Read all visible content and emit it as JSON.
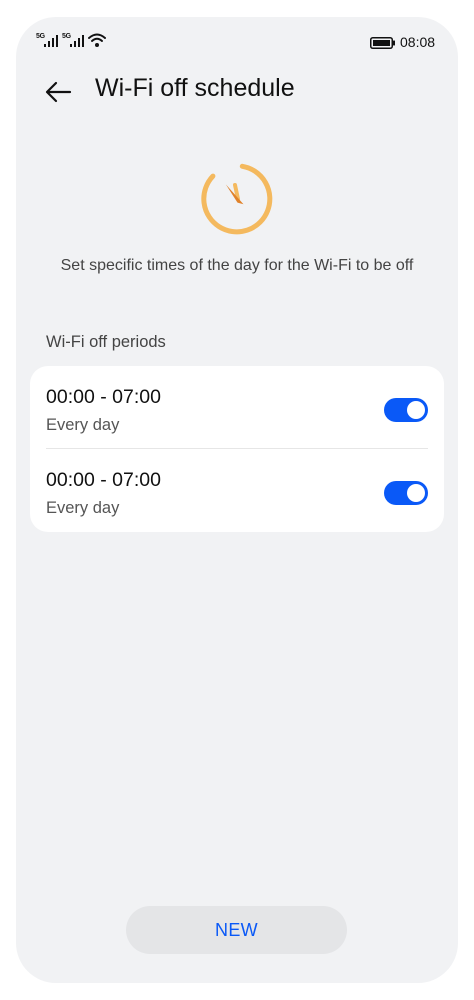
{
  "status_bar": {
    "signal_1_tag": "5G",
    "signal_2_tag": "5G",
    "wifi_icon": "wifi-icon",
    "battery_icon": "battery-icon",
    "time": "08:08"
  },
  "header": {
    "back_icon": "arrow-left-icon",
    "title": "Wi-Fi off schedule"
  },
  "hero": {
    "icon": "timer-icon",
    "icon_color": "#f4b95e",
    "description": "Set specific times of the day for the Wi-Fi to be off"
  },
  "periods": {
    "section_label": "Wi-Fi off periods",
    "items": [
      {
        "time_range": "00:00 - 07:00",
        "repeat": "Every day",
        "enabled": true
      },
      {
        "time_range": "00:00 - 07:00",
        "repeat": "Every day",
        "enabled": true
      }
    ]
  },
  "footer": {
    "new_label": "NEW"
  },
  "colors": {
    "accent": "#0a59f7",
    "background": "#f1f2f4",
    "card": "#ffffff"
  }
}
